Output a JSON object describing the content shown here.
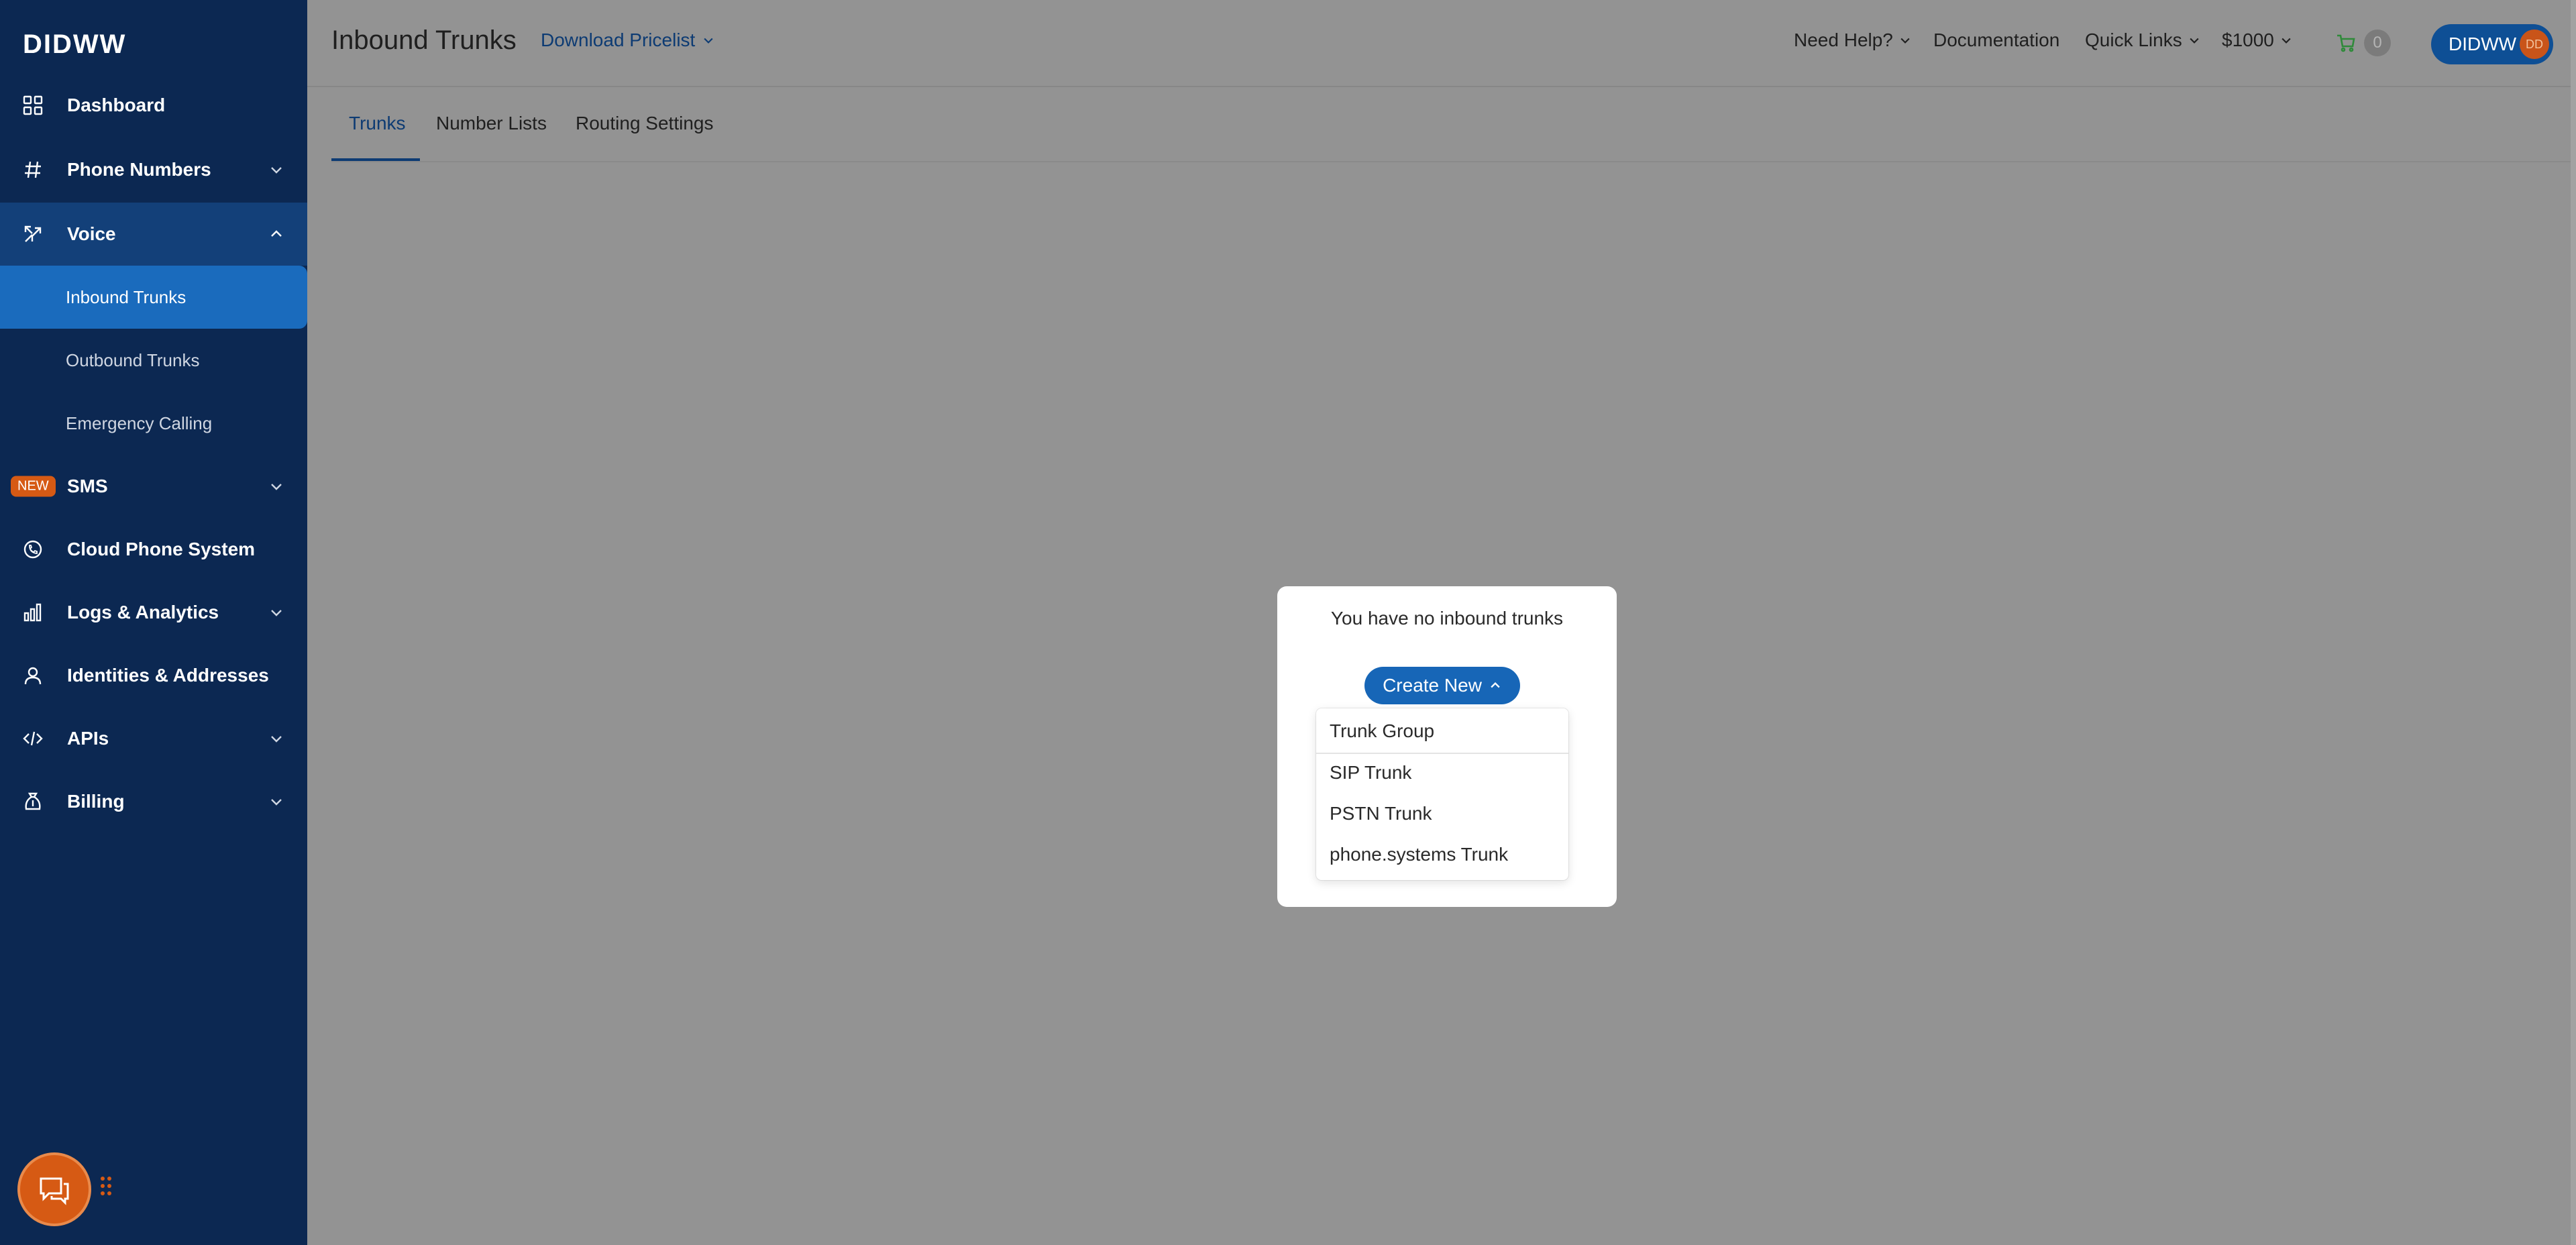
{
  "sidebar": {
    "logo": "DIDWW",
    "items": [
      {
        "label": "Dashboard"
      },
      {
        "label": "Phone Numbers"
      },
      {
        "label": "Voice"
      },
      {
        "label": "SMS",
        "badge": "NEW"
      },
      {
        "label": "Cloud Phone System"
      },
      {
        "label": "Logs & Analytics"
      },
      {
        "label": "Identities & Addresses"
      },
      {
        "label": "APIs"
      },
      {
        "label": "Billing"
      }
    ],
    "voice_sub": [
      {
        "label": "Inbound Trunks"
      },
      {
        "label": "Outbound Trunks"
      },
      {
        "label": "Emergency Calling"
      }
    ]
  },
  "header": {
    "title": "Inbound Trunks",
    "pricelist": "Download Pricelist",
    "need_help": "Need Help?",
    "documentation": "Documentation",
    "quick_links": "Quick Links",
    "balance": "$1000",
    "cart_count": "0",
    "account": "DIDWW",
    "avatar_initials": "DD"
  },
  "tabs": [
    {
      "label": "Trunks"
    },
    {
      "label": "Number Lists"
    },
    {
      "label": "Routing Settings"
    }
  ],
  "empty_state": {
    "message": "You have no inbound trunks",
    "create_label": "Create New",
    "options": [
      "Trunk Group",
      "SIP Trunk",
      "PSTN Trunk",
      "phone.systems Trunk"
    ]
  },
  "colors": {
    "sidebar_bg": "#0c2852",
    "selected_item": "#1a6bbd",
    "primary_button": "#1766b7",
    "accent_orange": "#d65a14",
    "overlay_bg": "#939393"
  }
}
